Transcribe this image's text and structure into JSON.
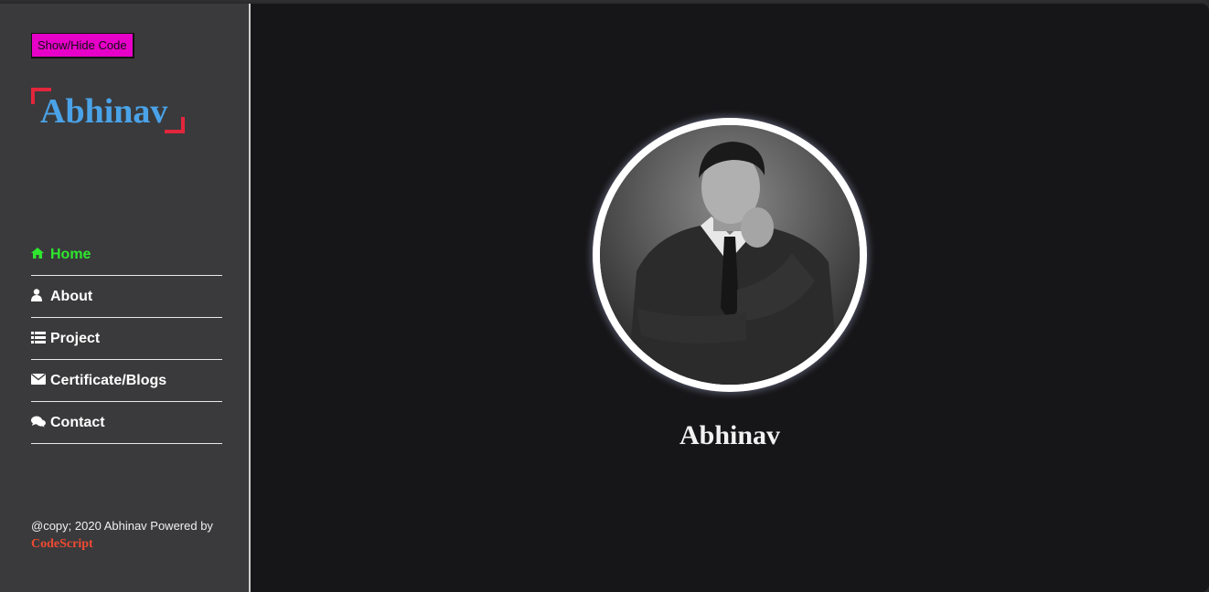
{
  "toolbar": {
    "toggle_label": "Show/Hide Code"
  },
  "brand": {
    "logo_text": "Abhinav"
  },
  "nav": {
    "items": [
      {
        "label": "Home",
        "icon": "home-icon",
        "glyph": "⌂"
      },
      {
        "label": "About",
        "icon": "user-icon",
        "glyph": "👤"
      },
      {
        "label": "Project",
        "icon": "list-icon",
        "glyph": "☰"
      },
      {
        "label": "Certificate/Blogs",
        "icon": "envelope-icon",
        "glyph": "✉"
      },
      {
        "label": "Contact",
        "icon": "comments-icon",
        "glyph": "💬"
      }
    ],
    "active": "Home"
  },
  "footer": {
    "text": "@copy; 2020 Abhinav Powered by",
    "link": "CodeScript"
  },
  "profile": {
    "name": "Abhinav"
  },
  "colors": {
    "sidebar_bg": "#3a3a3c",
    "main_bg": "#161618",
    "accent_green": "#2ee82e",
    "logo_blue": "#4aa3e8",
    "logo_bracket_red": "#e2263c",
    "button_magenta": "#e600c8",
    "link_red": "#f04a32"
  }
}
